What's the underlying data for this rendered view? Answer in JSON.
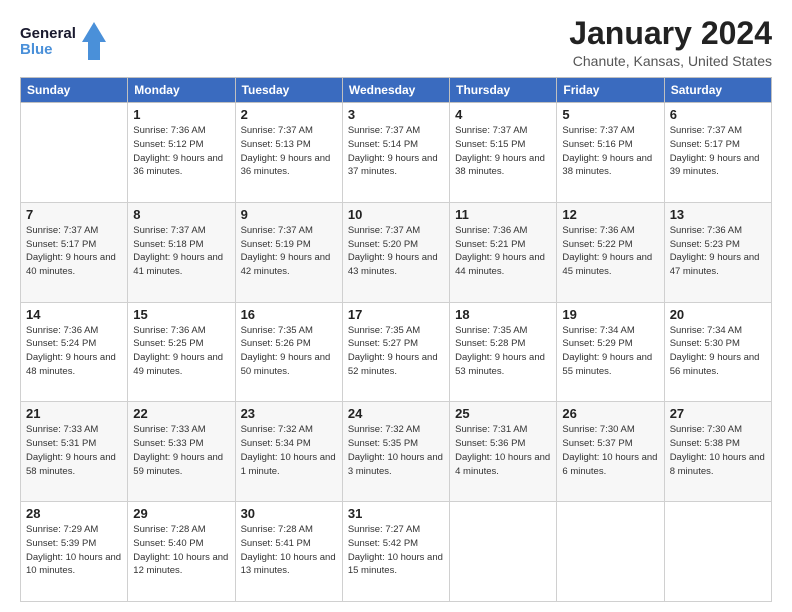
{
  "header": {
    "logo_line1": "General",
    "logo_line2": "Blue",
    "month": "January 2024",
    "location": "Chanute, Kansas, United States"
  },
  "days_of_week": [
    "Sunday",
    "Monday",
    "Tuesday",
    "Wednesday",
    "Thursday",
    "Friday",
    "Saturday"
  ],
  "weeks": [
    [
      {
        "day": "",
        "sunrise": "",
        "sunset": "",
        "daylight": ""
      },
      {
        "day": "1",
        "sunrise": "Sunrise: 7:36 AM",
        "sunset": "Sunset: 5:12 PM",
        "daylight": "Daylight: 9 hours and 36 minutes."
      },
      {
        "day": "2",
        "sunrise": "Sunrise: 7:37 AM",
        "sunset": "Sunset: 5:13 PM",
        "daylight": "Daylight: 9 hours and 36 minutes."
      },
      {
        "day": "3",
        "sunrise": "Sunrise: 7:37 AM",
        "sunset": "Sunset: 5:14 PM",
        "daylight": "Daylight: 9 hours and 37 minutes."
      },
      {
        "day": "4",
        "sunrise": "Sunrise: 7:37 AM",
        "sunset": "Sunset: 5:15 PM",
        "daylight": "Daylight: 9 hours and 38 minutes."
      },
      {
        "day": "5",
        "sunrise": "Sunrise: 7:37 AM",
        "sunset": "Sunset: 5:16 PM",
        "daylight": "Daylight: 9 hours and 38 minutes."
      },
      {
        "day": "6",
        "sunrise": "Sunrise: 7:37 AM",
        "sunset": "Sunset: 5:17 PM",
        "daylight": "Daylight: 9 hours and 39 minutes."
      }
    ],
    [
      {
        "day": "7",
        "sunrise": "Sunrise: 7:37 AM",
        "sunset": "Sunset: 5:17 PM",
        "daylight": "Daylight: 9 hours and 40 minutes."
      },
      {
        "day": "8",
        "sunrise": "Sunrise: 7:37 AM",
        "sunset": "Sunset: 5:18 PM",
        "daylight": "Daylight: 9 hours and 41 minutes."
      },
      {
        "day": "9",
        "sunrise": "Sunrise: 7:37 AM",
        "sunset": "Sunset: 5:19 PM",
        "daylight": "Daylight: 9 hours and 42 minutes."
      },
      {
        "day": "10",
        "sunrise": "Sunrise: 7:37 AM",
        "sunset": "Sunset: 5:20 PM",
        "daylight": "Daylight: 9 hours and 43 minutes."
      },
      {
        "day": "11",
        "sunrise": "Sunrise: 7:36 AM",
        "sunset": "Sunset: 5:21 PM",
        "daylight": "Daylight: 9 hours and 44 minutes."
      },
      {
        "day": "12",
        "sunrise": "Sunrise: 7:36 AM",
        "sunset": "Sunset: 5:22 PM",
        "daylight": "Daylight: 9 hours and 45 minutes."
      },
      {
        "day": "13",
        "sunrise": "Sunrise: 7:36 AM",
        "sunset": "Sunset: 5:23 PM",
        "daylight": "Daylight: 9 hours and 47 minutes."
      }
    ],
    [
      {
        "day": "14",
        "sunrise": "Sunrise: 7:36 AM",
        "sunset": "Sunset: 5:24 PM",
        "daylight": "Daylight: 9 hours and 48 minutes."
      },
      {
        "day": "15",
        "sunrise": "Sunrise: 7:36 AM",
        "sunset": "Sunset: 5:25 PM",
        "daylight": "Daylight: 9 hours and 49 minutes."
      },
      {
        "day": "16",
        "sunrise": "Sunrise: 7:35 AM",
        "sunset": "Sunset: 5:26 PM",
        "daylight": "Daylight: 9 hours and 50 minutes."
      },
      {
        "day": "17",
        "sunrise": "Sunrise: 7:35 AM",
        "sunset": "Sunset: 5:27 PM",
        "daylight": "Daylight: 9 hours and 52 minutes."
      },
      {
        "day": "18",
        "sunrise": "Sunrise: 7:35 AM",
        "sunset": "Sunset: 5:28 PM",
        "daylight": "Daylight: 9 hours and 53 minutes."
      },
      {
        "day": "19",
        "sunrise": "Sunrise: 7:34 AM",
        "sunset": "Sunset: 5:29 PM",
        "daylight": "Daylight: 9 hours and 55 minutes."
      },
      {
        "day": "20",
        "sunrise": "Sunrise: 7:34 AM",
        "sunset": "Sunset: 5:30 PM",
        "daylight": "Daylight: 9 hours and 56 minutes."
      }
    ],
    [
      {
        "day": "21",
        "sunrise": "Sunrise: 7:33 AM",
        "sunset": "Sunset: 5:31 PM",
        "daylight": "Daylight: 9 hours and 58 minutes."
      },
      {
        "day": "22",
        "sunrise": "Sunrise: 7:33 AM",
        "sunset": "Sunset: 5:33 PM",
        "daylight": "Daylight: 9 hours and 59 minutes."
      },
      {
        "day": "23",
        "sunrise": "Sunrise: 7:32 AM",
        "sunset": "Sunset: 5:34 PM",
        "daylight": "Daylight: 10 hours and 1 minute."
      },
      {
        "day": "24",
        "sunrise": "Sunrise: 7:32 AM",
        "sunset": "Sunset: 5:35 PM",
        "daylight": "Daylight: 10 hours and 3 minutes."
      },
      {
        "day": "25",
        "sunrise": "Sunrise: 7:31 AM",
        "sunset": "Sunset: 5:36 PM",
        "daylight": "Daylight: 10 hours and 4 minutes."
      },
      {
        "day": "26",
        "sunrise": "Sunrise: 7:30 AM",
        "sunset": "Sunset: 5:37 PM",
        "daylight": "Daylight: 10 hours and 6 minutes."
      },
      {
        "day": "27",
        "sunrise": "Sunrise: 7:30 AM",
        "sunset": "Sunset: 5:38 PM",
        "daylight": "Daylight: 10 hours and 8 minutes."
      }
    ],
    [
      {
        "day": "28",
        "sunrise": "Sunrise: 7:29 AM",
        "sunset": "Sunset: 5:39 PM",
        "daylight": "Daylight: 10 hours and 10 minutes."
      },
      {
        "day": "29",
        "sunrise": "Sunrise: 7:28 AM",
        "sunset": "Sunset: 5:40 PM",
        "daylight": "Daylight: 10 hours and 12 minutes."
      },
      {
        "day": "30",
        "sunrise": "Sunrise: 7:28 AM",
        "sunset": "Sunset: 5:41 PM",
        "daylight": "Daylight: 10 hours and 13 minutes."
      },
      {
        "day": "31",
        "sunrise": "Sunrise: 7:27 AM",
        "sunset": "Sunset: 5:42 PM",
        "daylight": "Daylight: 10 hours and 15 minutes."
      },
      {
        "day": "",
        "sunrise": "",
        "sunset": "",
        "daylight": ""
      },
      {
        "day": "",
        "sunrise": "",
        "sunset": "",
        "daylight": ""
      },
      {
        "day": "",
        "sunrise": "",
        "sunset": "",
        "daylight": ""
      }
    ]
  ]
}
